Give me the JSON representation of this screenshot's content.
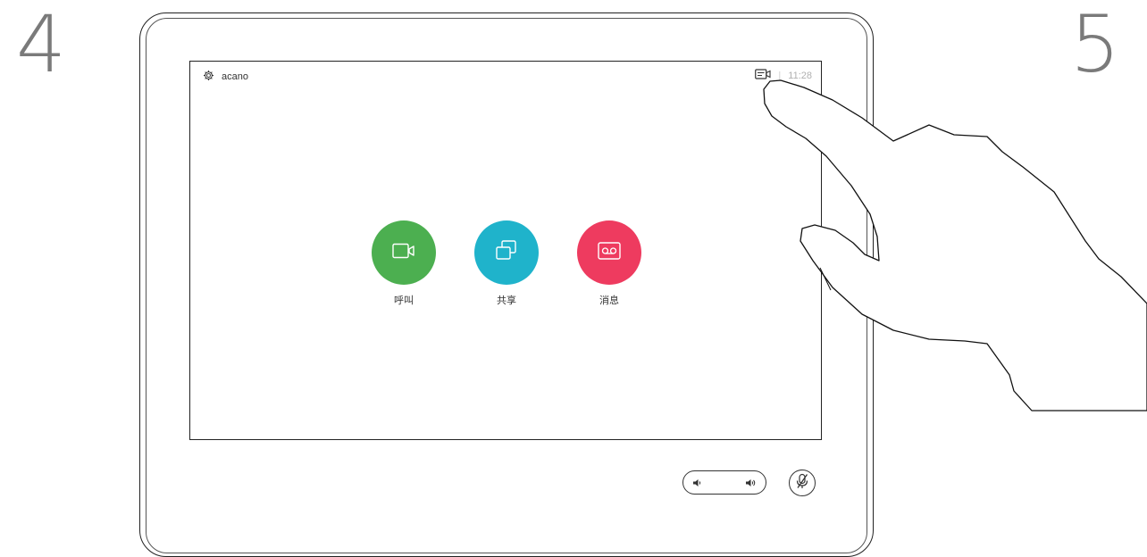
{
  "steps": {
    "left": "4",
    "right": "5"
  },
  "status_bar": {
    "system_name": "acano",
    "time": "11:28",
    "separator": "|"
  },
  "actions": [
    {
      "label": "呼叫",
      "icon": "video-camera-icon",
      "color": "#4caf50"
    },
    {
      "label": "共享",
      "icon": "share-screens-icon",
      "color": "#1fb3cb"
    },
    {
      "label": "消息",
      "icon": "voicemail-icon",
      "color": "#ee3b5f"
    }
  ],
  "controls": {
    "volume_down_icon": "volume-down-icon",
    "volume_up_icon": "volume-up-icon",
    "mute_icon": "microphone-muted-icon"
  },
  "overlay": {
    "hand": "pointing-hand-icon"
  }
}
